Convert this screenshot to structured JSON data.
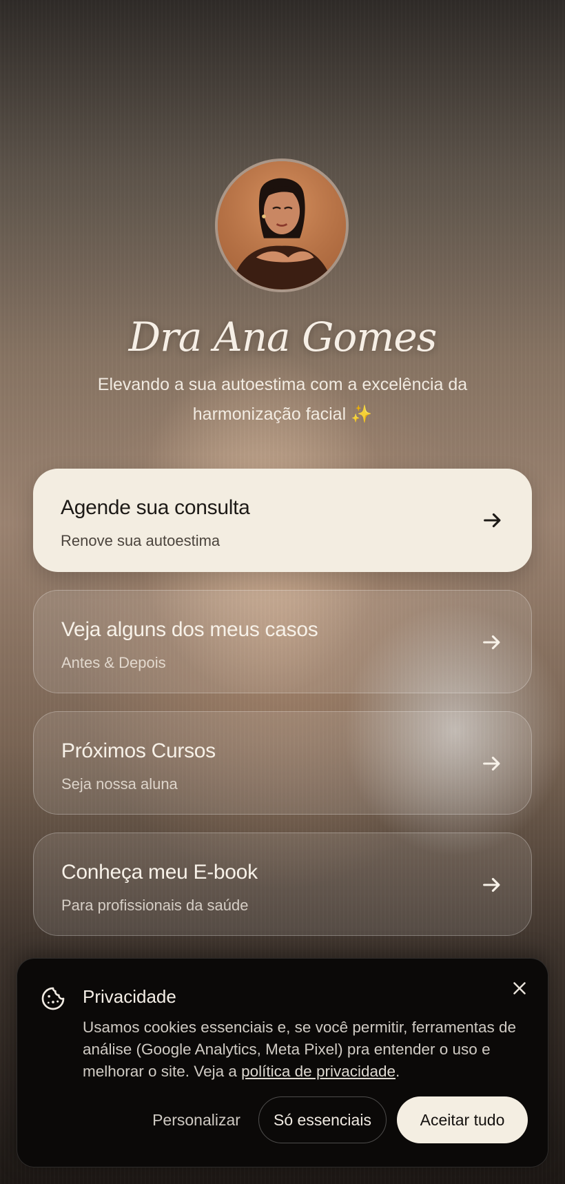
{
  "profile": {
    "name": "Dra Ana Gomes",
    "tagline": "Elevando a sua autoestima com a excelência da harmonização facial ✨",
    "avatar_icon": "profile-photo"
  },
  "links": [
    {
      "title": "Agende sua consulta",
      "subtitle": "Renove sua autoestima",
      "primary": true
    },
    {
      "title": "Veja alguns dos meus casos",
      "subtitle": "Antes & Depois"
    },
    {
      "title": "Próximos Cursos",
      "subtitle": "Seja nossa aluna"
    },
    {
      "title": "Conheça meu E-book",
      "subtitle": "Para profissionais da saúde"
    }
  ],
  "cookie_banner": {
    "title": "Privacidade",
    "text_before_link": "Usamos cookies essenciais e, se você permitir, ferramentas de análise (Google Analytics, Meta Pixel) pra entender o uso e melhorar o site. Veja a ",
    "link_text": "política de privacidade",
    "text_after_link": ".",
    "buttons": {
      "customize": "Personalizar",
      "essentials": "Só essenciais",
      "accept": "Aceitar tudo"
    }
  },
  "colors": {
    "primary_card": "#f3ede1",
    "banner_bg": "#0b0908",
    "accept_button": "#f4eee2"
  }
}
